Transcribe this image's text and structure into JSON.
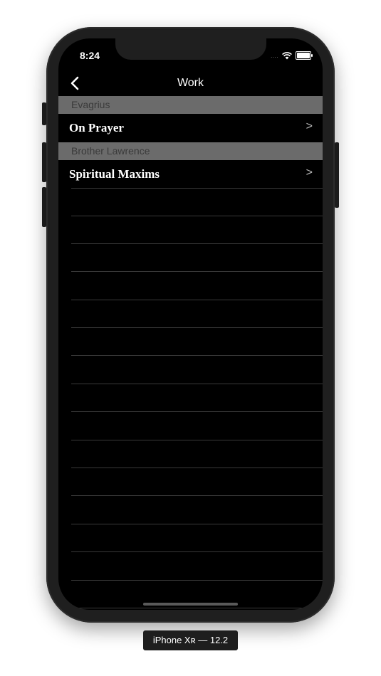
{
  "status_bar": {
    "time": "8:24",
    "signal": "....",
    "icons": [
      "wifi-icon",
      "battery-icon"
    ]
  },
  "nav": {
    "title": "Work",
    "back_icon": "chevron-left-icon"
  },
  "sections": [
    {
      "header": "Evagrius",
      "rows": [
        {
          "label": "On Prayer"
        }
      ]
    },
    {
      "header": "Brother Lawrence",
      "rows": [
        {
          "label": "Spiritual Maxims"
        }
      ]
    }
  ],
  "row_chevron": ">",
  "device_label": "iPhone Xʀ — 12.2",
  "colors": {
    "background": "#000000",
    "section_header_bg": "#6b6b6b",
    "section_header_text": "#3a3a3a",
    "row_text": "#ffffff"
  }
}
